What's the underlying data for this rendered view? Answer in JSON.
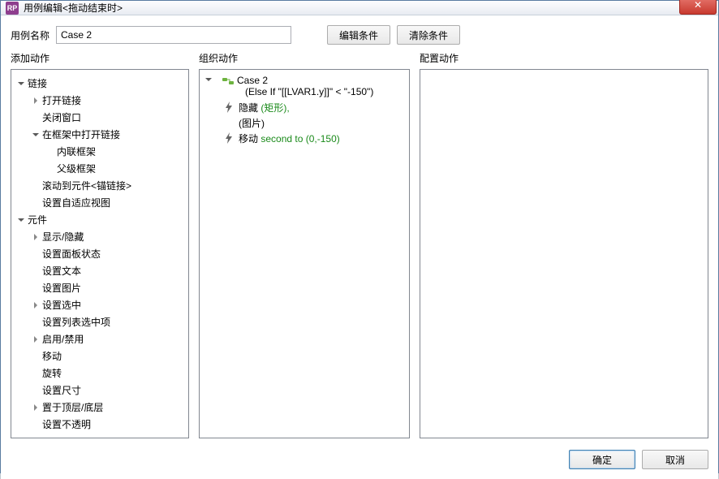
{
  "window": {
    "app_icon_text": "RP",
    "title": "用例编辑<拖动结束时>",
    "close_glyph": "✕"
  },
  "top": {
    "name_label": "用例名称",
    "case_value": "Case 2",
    "edit_condition": "编辑条件",
    "clear_condition": "清除条件"
  },
  "headers": {
    "add_action": "添加动作",
    "organize_action": "组织动作",
    "configure_action": "配置动作"
  },
  "tree": [
    {
      "indent": 0,
      "exp": "down",
      "label": "链接"
    },
    {
      "indent": 1,
      "exp": "right",
      "label": "打开链接"
    },
    {
      "indent": 1,
      "exp": "blank",
      "label": "关闭窗口"
    },
    {
      "indent": 1,
      "exp": "down",
      "label": "在框架中打开链接"
    },
    {
      "indent": 2,
      "exp": "blank",
      "label": "内联框架"
    },
    {
      "indent": 2,
      "exp": "blank",
      "label": "父级框架"
    },
    {
      "indent": 1,
      "exp": "blank",
      "label": "滚动到元件<锚链接>"
    },
    {
      "indent": 1,
      "exp": "blank",
      "label": "设置自适应视图"
    },
    {
      "indent": 0,
      "exp": "down",
      "label": "元件"
    },
    {
      "indent": 1,
      "exp": "right",
      "label": "显示/隐藏"
    },
    {
      "indent": 1,
      "exp": "blank",
      "label": "设置面板状态"
    },
    {
      "indent": 1,
      "exp": "blank",
      "label": "设置文本"
    },
    {
      "indent": 1,
      "exp": "blank",
      "label": "设置图片"
    },
    {
      "indent": 1,
      "exp": "right",
      "label": "设置选中"
    },
    {
      "indent": 1,
      "exp": "blank",
      "label": "设置列表选中项"
    },
    {
      "indent": 1,
      "exp": "right",
      "label": "启用/禁用"
    },
    {
      "indent": 1,
      "exp": "blank",
      "label": "移动"
    },
    {
      "indent": 1,
      "exp": "blank",
      "label": "旋转"
    },
    {
      "indent": 1,
      "exp": "blank",
      "label": "设置尺寸"
    },
    {
      "indent": 1,
      "exp": "right",
      "label": "置于顶层/底层"
    },
    {
      "indent": 1,
      "exp": "blank",
      "label": "设置不透明"
    }
  ],
  "org": {
    "case_name": "Case 2",
    "case_condition": "(Else If \"[[LVAR1.y]]\" < \"-150\")",
    "actions": [
      {
        "prefix": "隐藏 ",
        "green": "(矩形),",
        "sub_green": "(图片)"
      },
      {
        "prefix": "移动 ",
        "green": "second to (0,-150)"
      }
    ]
  },
  "footer": {
    "ok": "确定",
    "cancel": "取消"
  }
}
